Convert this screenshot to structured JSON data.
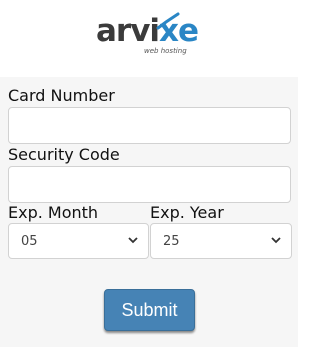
{
  "brand": {
    "name_main": "arvi",
    "name_accent": "xe",
    "tagline": "web hosting",
    "accent_color": "#2a86c5"
  },
  "form": {
    "card_number": {
      "label": "Card Number",
      "value": "",
      "placeholder": ""
    },
    "security_code": {
      "label": "Security Code",
      "value": "",
      "placeholder": ""
    },
    "exp_month": {
      "label": "Exp. Month",
      "selected": "05"
    },
    "exp_year": {
      "label": "Exp. Year",
      "selected": "25"
    },
    "submit_label": "Submit",
    "button_color": "#4683b5"
  }
}
